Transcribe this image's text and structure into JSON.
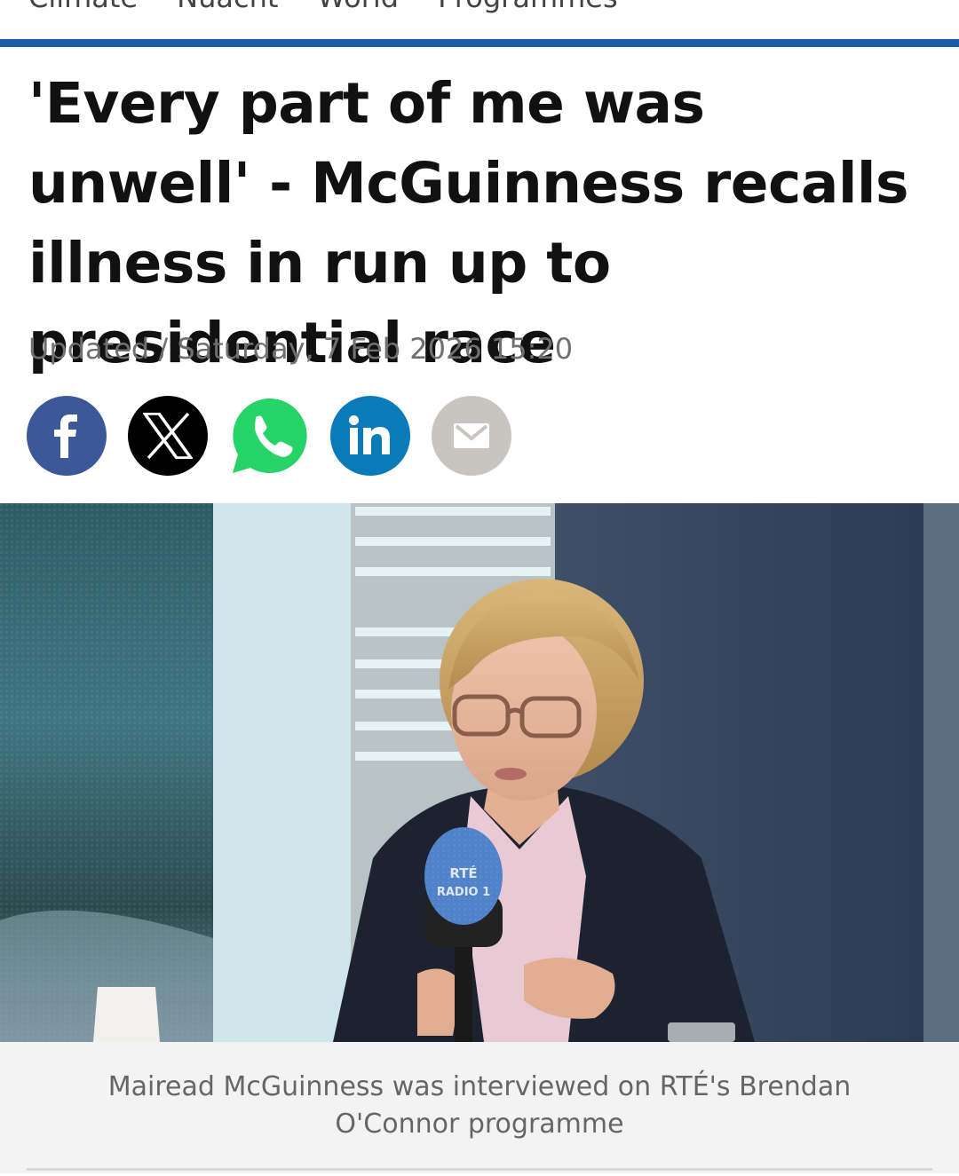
{
  "nav": {
    "items": [
      "Climate",
      "Nuacht",
      "World",
      "Programmes"
    ]
  },
  "article": {
    "headline": "'Every part of me was unwell' - McGuinness recalls illness in run up to presidential race",
    "updated": "Updated / Saturday, 7 Feb 2026 15:20"
  },
  "share": [
    {
      "name": "facebook",
      "icon": "facebook-icon",
      "color": "#3b5998"
    },
    {
      "name": "x",
      "icon": "x-icon",
      "color": "#000000"
    },
    {
      "name": "whatsapp",
      "icon": "whatsapp-icon",
      "color": "#25d366"
    },
    {
      "name": "linkedin",
      "icon": "linkedin-icon",
      "color": "#0a7bb8"
    },
    {
      "name": "email",
      "icon": "mail-icon",
      "color": "#c8c5c1"
    }
  ],
  "photo": {
    "mic_label_line1": "RTÉ",
    "mic_label_line2": "RADIO 1"
  },
  "caption": "Mairead McGuinness was interviewed on RTÉ's Brendan O'Connor programme",
  "colors": {
    "accent": "#1b5ba8"
  }
}
